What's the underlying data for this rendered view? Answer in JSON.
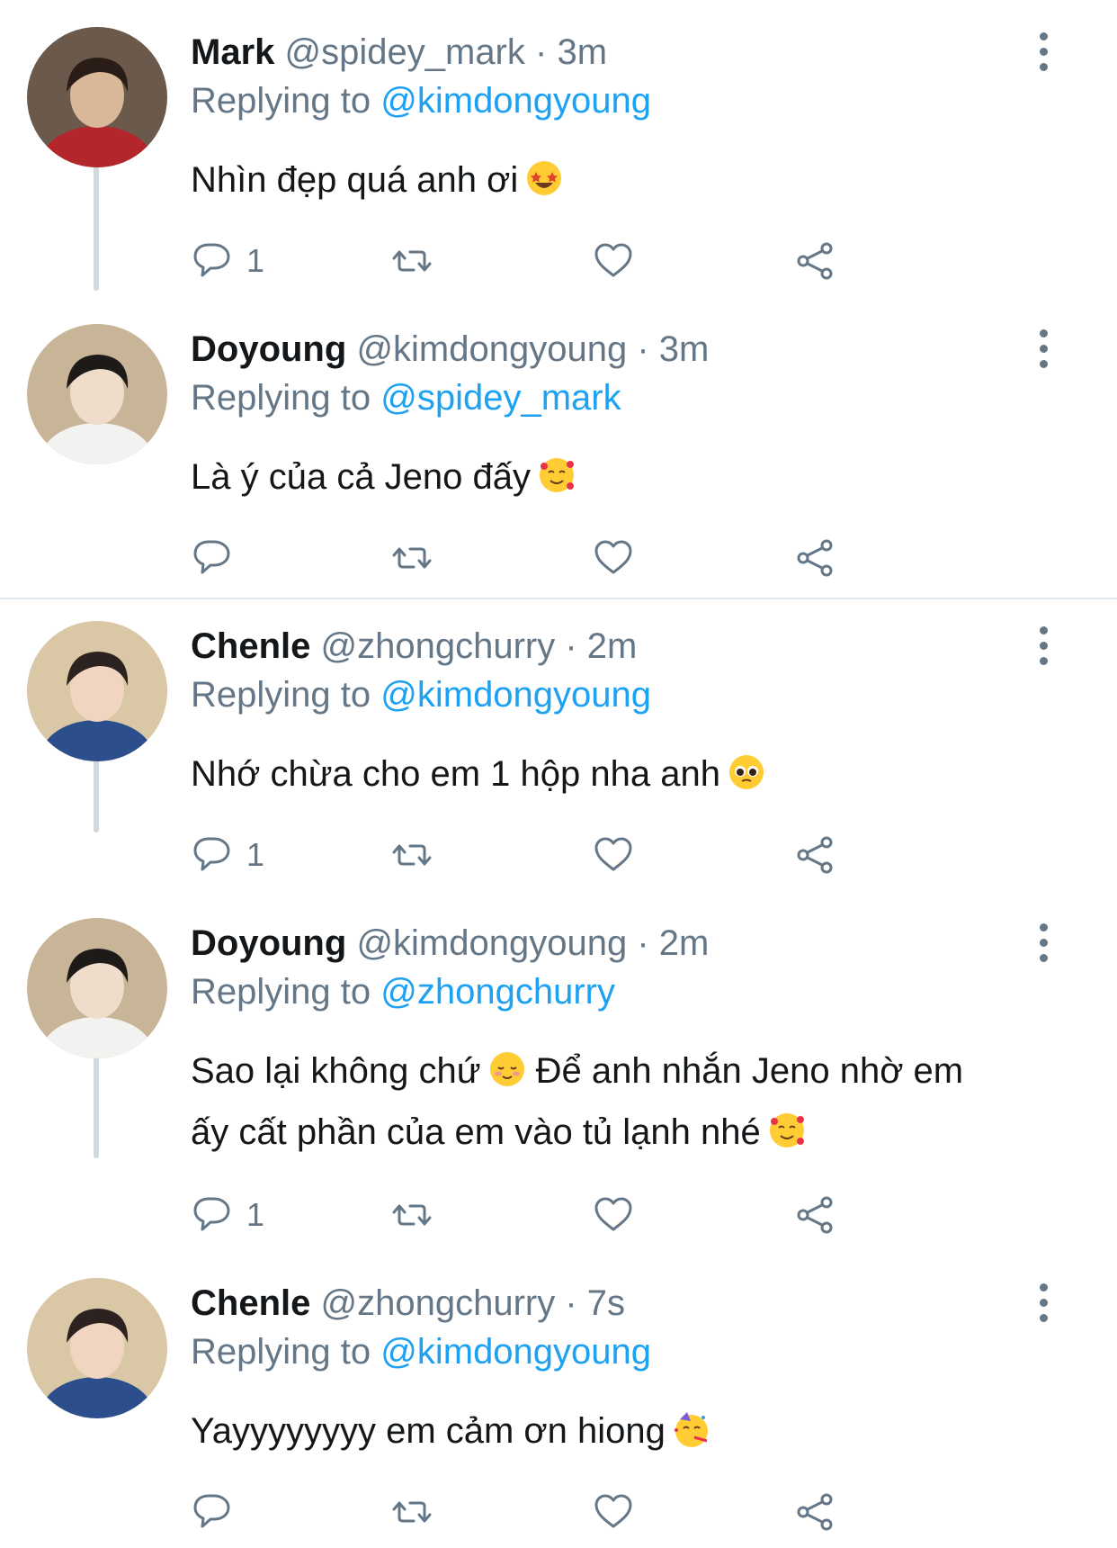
{
  "tweets": [
    {
      "name": "Mark",
      "handle": "@spidey_mark",
      "time": "3m",
      "replying_prefix": "Replying to",
      "replying_to": "@kimdongyoung",
      "text": "Nhìn đẹp quá anh ơi",
      "emoji": "star-struck-emoji",
      "reply_count": "1",
      "avatar_colors": {
        "bg": "#6b5a4c",
        "face": "#d9b89a",
        "hair": "#2a1d17",
        "accent": "#b3262c"
      }
    },
    {
      "name": "Doyoung",
      "handle": "@kimdongyoung",
      "time": "3m",
      "replying_prefix": "Replying to",
      "replying_to": "@spidey_mark",
      "text": "Là ý của cả Jeno đấy",
      "emoji": "smiling-face-with-hearts-emoji",
      "reply_count": "",
      "avatar_colors": {
        "bg": "#c8b497",
        "face": "#efdccb",
        "hair": "#1e1a18",
        "accent": "#f2f2f0"
      }
    },
    {
      "name": "Chenle",
      "handle": "@zhongchurry",
      "time": "2m",
      "replying_prefix": "Replying to",
      "replying_to": "@kimdongyoung",
      "text": "Nhớ chừa cho em 1 hộp nha anh",
      "emoji": "pleading-face-emoji",
      "reply_count": "1",
      "avatar_colors": {
        "bg": "#d9c7a6",
        "face": "#f0d6c0",
        "hair": "#2c2220",
        "accent": "#2c4e8c"
      }
    },
    {
      "name": "Doyoung",
      "handle": "@kimdongyoung",
      "time": "2m",
      "replying_prefix": "Replying to",
      "replying_to": "@zhongchurry",
      "text_line1": "Sao lại không chứ",
      "emoji_a": "relieved-smiling-emoji",
      "text_line1b": "Để anh nhắn Jeno nhờ em",
      "text_line2": "ấy cất phần của em vào tủ lạnh nhé",
      "emoji_b": "smiling-face-with-hearts-emoji",
      "reply_count": "1",
      "avatar_colors": {
        "bg": "#c8b497",
        "face": "#efdccb",
        "hair": "#1e1a18",
        "accent": "#f2f2f0"
      }
    },
    {
      "name": "Chenle",
      "handle": "@zhongchurry",
      "time": "7s",
      "replying_prefix": "Replying to",
      "replying_to": "@kimdongyoung",
      "text": "Yayyyyyyyy em cảm ơn hiong",
      "emoji": "partying-face-emoji",
      "reply_count": "",
      "avatar_colors": {
        "bg": "#d9c7a6",
        "face": "#f0d6c0",
        "hair": "#2c2220",
        "accent": "#2c4e8c"
      }
    }
  ],
  "separator": "·",
  "colors": {
    "text": "#14171a",
    "muted": "#657786",
    "link": "#1da1f2",
    "line": "#cfd9de"
  }
}
